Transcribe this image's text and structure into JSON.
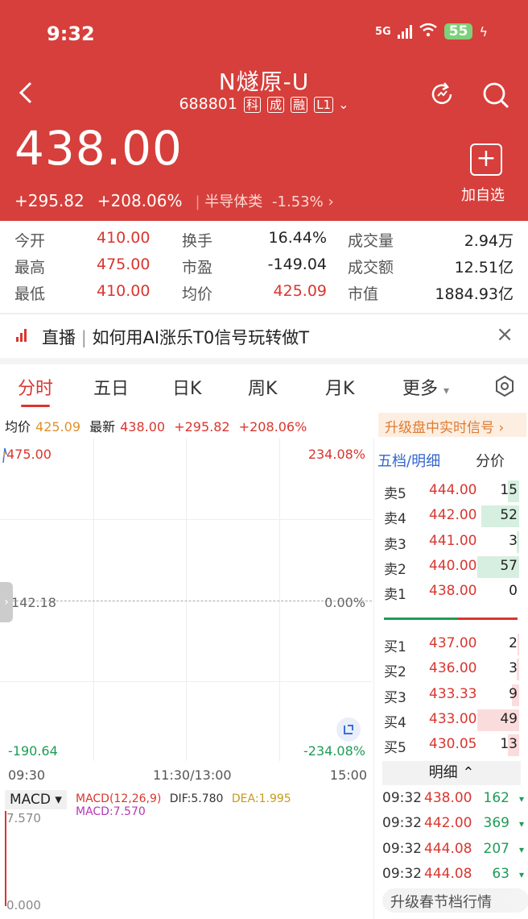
{
  "status": {
    "time": "9:32",
    "network": "5G",
    "battery": "55"
  },
  "header": {
    "name": "N燧原-U",
    "code": "688801",
    "tags": [
      "科",
      "成",
      "融",
      "L1"
    ],
    "price": "438.00",
    "change": "+295.82",
    "change_pct": "+208.06%",
    "sector": "半导体类",
    "sector_change": "-1.53%",
    "add_label": "加自选",
    "add_symbol": "+"
  },
  "stats": [
    [
      "今开",
      "410.00",
      "换手",
      "16.44%",
      "成交量",
      "2.94万"
    ],
    [
      "最高",
      "475.00",
      "市盈",
      "-149.04",
      "成交额",
      "12.51亿"
    ],
    [
      "最低",
      "410.00",
      "均价",
      "425.09",
      "市值",
      "1884.93亿"
    ]
  ],
  "live": {
    "label": "直播",
    "title": "如何用AI涨乐T0信号玩转做T",
    "close": "×"
  },
  "tabs": [
    "分时",
    "五日",
    "日K",
    "周K",
    "月K",
    "更多"
  ],
  "info_bar": {
    "avg_label": "均价",
    "avg_value": "425.09",
    "latest_label": "最新",
    "latest_value": "438.00",
    "change": "+295.82",
    "change_pct": "+208.06%",
    "upgrade": "升级盘中实时信号 ›"
  },
  "chart": {
    "y_top": "475.00",
    "y_mid": "142.18",
    "y_bottom": "-190.64",
    "pct_top": "234.08%",
    "pct_mid": "0.00%",
    "pct_bottom": "-234.08%",
    "times": [
      "09:30",
      "11:30/13:00",
      "15:00"
    ]
  },
  "macd": {
    "indicator": "MACD ▾",
    "params": "MACD(12,26,9)",
    "dif": "DIF:5.780",
    "dea": "DEA:1.995",
    "macd": "MACD:7.570",
    "top": "7.570",
    "bottom": "0.000"
  },
  "book": {
    "tab_label": "五档/明细",
    "split_label": "分价",
    "asks": [
      {
        "label": "卖5",
        "price": "444.00",
        "qty": "15",
        "fill": 0.26
      },
      {
        "label": "卖4",
        "price": "442.00",
        "qty": "52",
        "fill": 0.91
      },
      {
        "label": "卖3",
        "price": "441.00",
        "qty": "3",
        "fill": 0.05
      },
      {
        "label": "卖2",
        "price": "440.00",
        "qty": "57",
        "fill": 1.0
      },
      {
        "label": "卖1",
        "price": "438.00",
        "qty": "0",
        "fill": 0
      }
    ],
    "bids": [
      {
        "label": "买1",
        "price": "437.00",
        "qty": "2",
        "fill": 0.04
      },
      {
        "label": "买2",
        "price": "436.00",
        "qty": "3",
        "fill": 0.06
      },
      {
        "label": "买3",
        "price": "433.33",
        "qty": "9",
        "fill": 0.18
      },
      {
        "label": "买4",
        "price": "433.00",
        "qty": "49",
        "fill": 1.0
      },
      {
        "label": "买5",
        "price": "430.05",
        "qty": "13",
        "fill": 0.27
      }
    ],
    "detail_label": "明细 ⌃",
    "ticks": [
      {
        "time": "09:32",
        "price": "438.00",
        "vol": "162",
        "dir": "▾"
      },
      {
        "time": "09:32",
        "price": "442.00",
        "vol": "369",
        "dir": "▾"
      },
      {
        "time": "09:32",
        "price": "444.08",
        "vol": "207",
        "dir": "▾"
      },
      {
        "time": "09:32",
        "price": "444.08",
        "vol": "63",
        "dir": "▾"
      }
    ],
    "bottom_cta": "升级春节档行情"
  },
  "colors": {
    "up": "#d9362f",
    "down": "#1e9c57",
    "header_bg": "#d63f3b"
  }
}
